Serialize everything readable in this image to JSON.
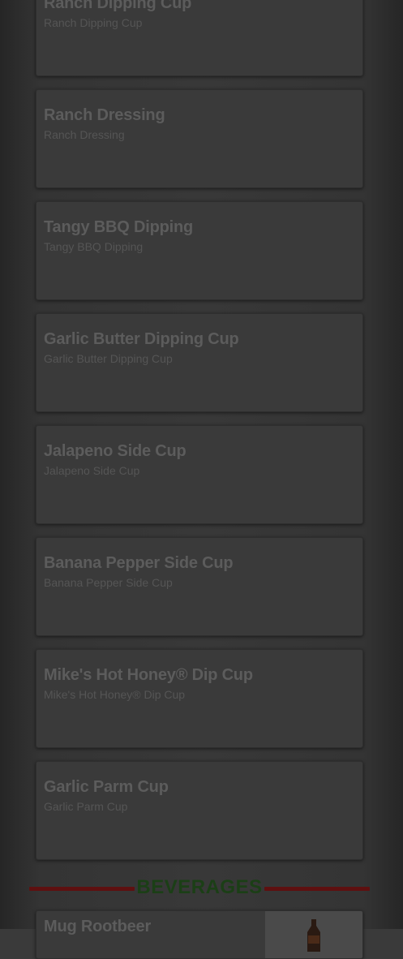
{
  "menu": {
    "items": [
      {
        "title": "Ranch Dipping Cup",
        "description": "Ranch Dipping Cup"
      },
      {
        "title": "Ranch Dressing",
        "description": "Ranch Dressing"
      },
      {
        "title": "Tangy BBQ Dipping",
        "description": "Tangy BBQ Dipping"
      },
      {
        "title": "Garlic Butter Dipping Cup",
        "description": "Garlic Butter Dipping Cup"
      },
      {
        "title": "Jalapeno Side Cup",
        "description": "Jalapeno Side Cup"
      },
      {
        "title": "Banana Pepper Side Cup",
        "description": "Banana Pepper Side Cup"
      },
      {
        "title": "Mike's Hot Honey® Dip Cup",
        "description": "Mike's Hot Honey® Dip Cup"
      },
      {
        "title": "Garlic Parm Cup",
        "description": "Garlic Parm Cup"
      }
    ]
  },
  "beverages": {
    "header": "BEVERAGES",
    "items": [
      {
        "title": "Mug Rootbeer",
        "image_icon": "bottle-icon"
      }
    ]
  },
  "colors": {
    "overlay": "#383838",
    "header_text": "#1b3f16",
    "header_rule": "#5e1010"
  }
}
